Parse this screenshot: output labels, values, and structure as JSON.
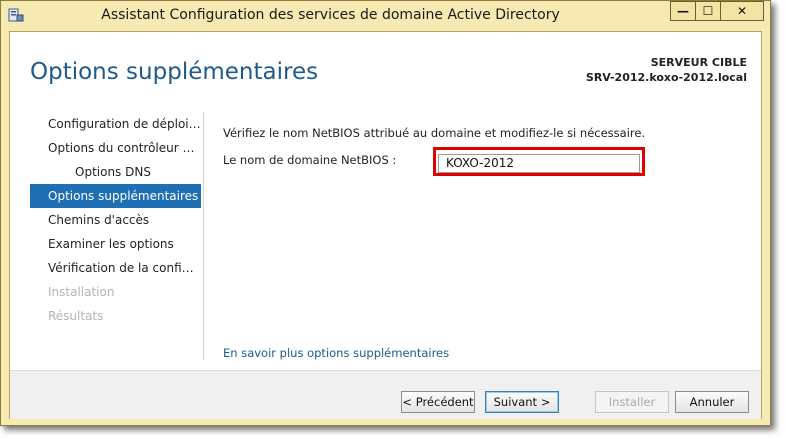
{
  "window": {
    "title": "Assistant Configuration des services de domaine Active Directory",
    "minimize_glyph": "—",
    "maximize_glyph": "☐",
    "close_glyph": "✕"
  },
  "header": {
    "page_title": "Options supplémentaires",
    "target_label": "SERVEUR CIBLE",
    "target_value": "SRV-2012.koxo-2012.local"
  },
  "nav": {
    "items": [
      {
        "label": "Configuration de déploie...",
        "state": "normal"
      },
      {
        "label": "Options du contrôleur de...",
        "state": "normal"
      },
      {
        "label": "Options DNS",
        "state": "sub"
      },
      {
        "label": "Options supplémentaires",
        "state": "active"
      },
      {
        "label": "Chemins d'accès",
        "state": "normal"
      },
      {
        "label": "Examiner les options",
        "state": "normal"
      },
      {
        "label": "Vérification de la configur...",
        "state": "normal"
      },
      {
        "label": "Installation",
        "state": "disabled"
      },
      {
        "label": "Résultats",
        "state": "disabled"
      }
    ]
  },
  "main": {
    "description": "Vérifiez le nom NetBIOS attribué au domaine et modifiez-le si nécessaire.",
    "netbios_label": "Le nom de domaine NetBIOS :",
    "netbios_value": "KOXO-2012",
    "help_link": "En savoir plus options supplémentaires"
  },
  "footer": {
    "previous": "< Précédent",
    "next": "Suivant >",
    "install": "Installer",
    "cancel": "Annuler"
  },
  "colors": {
    "title_blue": "#1e5b8a",
    "active_nav": "#1f6fb5",
    "highlight_red": "#e00000",
    "window_frame": "#f6e9b2"
  }
}
